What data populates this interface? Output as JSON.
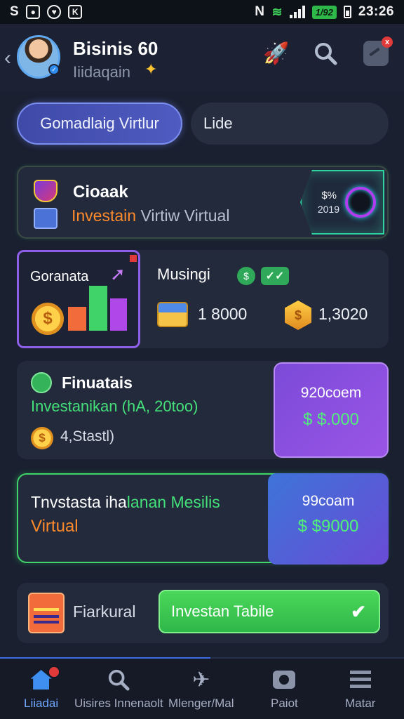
{
  "status_bar": {
    "left_icons": [
      "S",
      "camera-icon",
      "shield-icon",
      "k-icon"
    ],
    "battery": "1/92",
    "time": "23:26",
    "mute_icon": "N"
  },
  "header": {
    "title": "Bisinis 60",
    "subtitle": "Iiidaqain",
    "star": "✦"
  },
  "tabs": {
    "active": "Gomadlaig Virtlur",
    "other": "Lide"
  },
  "card1": {
    "title": "Cioaak",
    "subtitle_orange": "Investain",
    "subtitle_rest": " Virtiw Virtual",
    "hex_pct": "$%",
    "hex_year": "2019"
  },
  "card2": {
    "panel_title": "Goranata",
    "panel_coin": "$",
    "title": "Musingi",
    "badge1": "$",
    "badge2": "✓✓",
    "value1": "1 8000",
    "hexcoin": "$",
    "value2": "1,3020"
  },
  "card3": {
    "title": "Finuatais",
    "subtitle": "Investanikan (hA, 20too)",
    "coin": "$",
    "count": "4,Stastl)",
    "panel_label": "920coem",
    "panel_value": "$ $.000"
  },
  "card4": {
    "line1_white": "Tnvstasta iha",
    "line1_green": "lanan Mesilis",
    "line2": "Virtual",
    "panel_label": "99coam",
    "panel_value": "$ $9000"
  },
  "card5": {
    "label": "Fiarkural",
    "button": "Investan Tabile",
    "check": "✔"
  },
  "nav": {
    "items": [
      {
        "label": "Liiadai",
        "icon": "home-icon"
      },
      {
        "label": "Uisires Innenaolt",
        "icon": "search-icon"
      },
      {
        "label": "Mlenger/Mal",
        "icon": "rocket-icon"
      },
      {
        "label": "Paiot",
        "icon": "camera-icon"
      },
      {
        "label": "Matar",
        "icon": "menu-icon"
      }
    ]
  }
}
